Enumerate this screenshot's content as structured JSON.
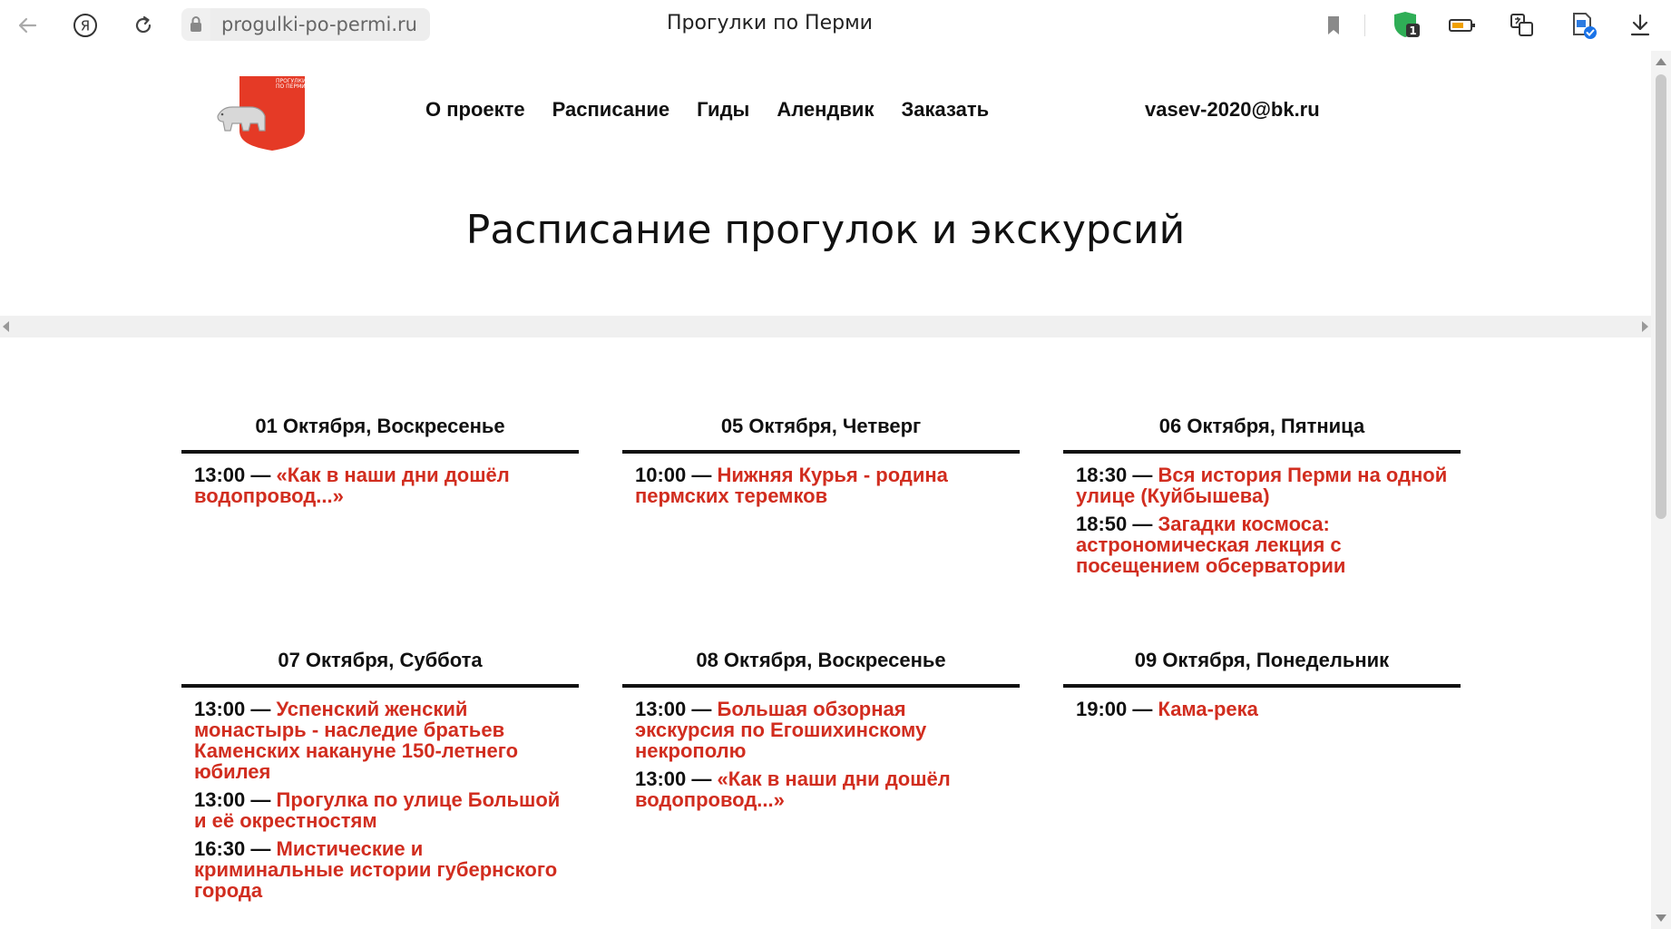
{
  "browser": {
    "url": "progulki-po-permi.ru",
    "tab_title": "Прогулки по Перми",
    "icons": [
      "back-arrow-icon",
      "yandex-icon",
      "reload-icon",
      "lock-icon",
      "bookmark-icon",
      "adblock-shield-icon",
      "battery-icon",
      "translate-icon",
      "document-check-icon",
      "download-icon"
    ],
    "shield_badge": "1"
  },
  "header": {
    "logo_alt": "Прогулки по Перми",
    "nav": [
      "О проекте",
      "Расписание",
      "Гиды",
      "Алендвик",
      "Заказать"
    ],
    "email": "vasev-2020@bk.ru"
  },
  "page_title": "Расписание прогулок и экскурсий",
  "accent_color": "#d12d1f",
  "days": [
    {
      "date": "01 Октября, Воскресенье",
      "events": [
        {
          "time": "13:00 — ",
          "title": "«Как в наши дни дошёл водопровод...»"
        }
      ]
    },
    {
      "date": "05 Октября, Четверг",
      "events": [
        {
          "time": "10:00 — ",
          "title": "Нижняя Курья - родина пермских теремков"
        }
      ]
    },
    {
      "date": "06 Октября, Пятница",
      "events": [
        {
          "time": "18:30 — ",
          "title": "Вся история Перми на одной улице (Куйбышева)"
        },
        {
          "time": "18:50 — ",
          "title": "Загадки космоса: астрономическая лекция с посещением обсерватории"
        }
      ]
    },
    {
      "date": "07 Октября, Суббота",
      "events": [
        {
          "time": "13:00 — ",
          "title": "Успенский женский монастырь - наследие братьев Каменских накануне 150-летнего юбилея"
        },
        {
          "time": "13:00 — ",
          "title": "Прогулка по улице Большой и её окрестностям"
        },
        {
          "time": "16:30 — ",
          "title": "Мистические и криминальные истории губернского города"
        }
      ]
    },
    {
      "date": "08 Октября, Воскресенье",
      "events": [
        {
          "time": "13:00 — ",
          "title": "Большая обзорная экскурсия по Егошихинскому некрополю"
        },
        {
          "time": "13:00 — ",
          "title": "«Как в наши дни дошёл водопровод...»"
        }
      ]
    },
    {
      "date": "09 Октября, Понедельник",
      "events": [
        {
          "time": "19:00 — ",
          "title": "Кама-река"
        }
      ]
    }
  ]
}
